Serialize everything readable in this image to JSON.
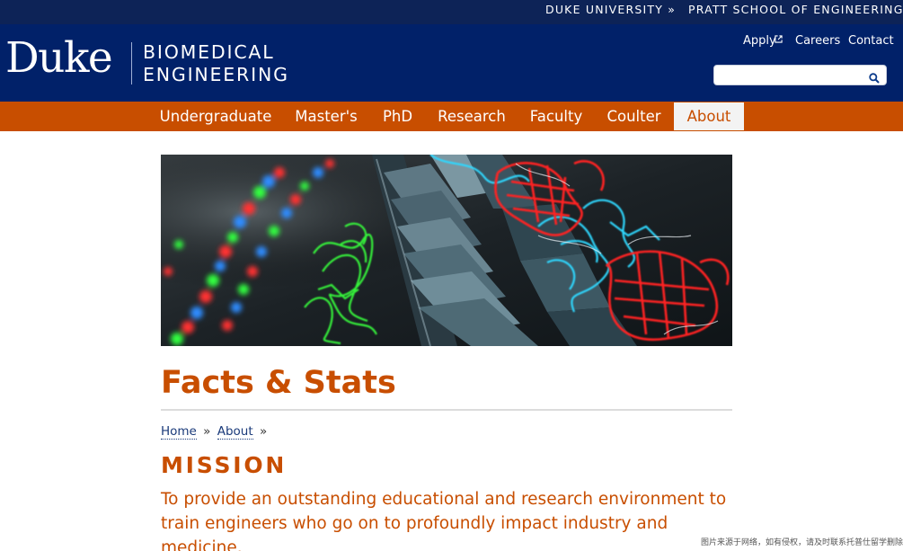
{
  "topbar": {
    "duke_university": "DUKE UNIVERSITY »",
    "pratt": "PRATT SCHOOL OF ENGINEERING »"
  },
  "header": {
    "logo_wordmark": "Duke",
    "dept_line1": "BIOMEDICAL",
    "dept_line2": "ENGINEERING",
    "util_links": {
      "apply": "Apply",
      "apply_icon": "external-link-icon",
      "careers": "Careers",
      "contact": "Contact"
    },
    "search": {
      "value": "",
      "placeholder": "",
      "icon": "search-icon"
    }
  },
  "nav": {
    "items": [
      {
        "label": "Undergraduate"
      },
      {
        "label": "Master's"
      },
      {
        "label": "PhD"
      },
      {
        "label": "Research"
      },
      {
        "label": "Faculty"
      },
      {
        "label": "Coulter"
      },
      {
        "label": "About"
      }
    ],
    "active": "About"
  },
  "page": {
    "title": "Facts & Stats",
    "breadcrumb": {
      "home": "Home",
      "about": "About",
      "separator": "»"
    },
    "mission_heading": "MISSION",
    "mission_text": "To provide an outstanding educational and research environment to train engineers who go on to profoundly impact industry and medicine."
  },
  "watermark": "图片来源于网络，如有侵权，请及时联系托普仕留学删除",
  "colors": {
    "topbar": "#0d2357",
    "header": "#012169",
    "nav": "#c84e00",
    "accent_text": "#c84e00",
    "link": "#1a3a7a"
  }
}
